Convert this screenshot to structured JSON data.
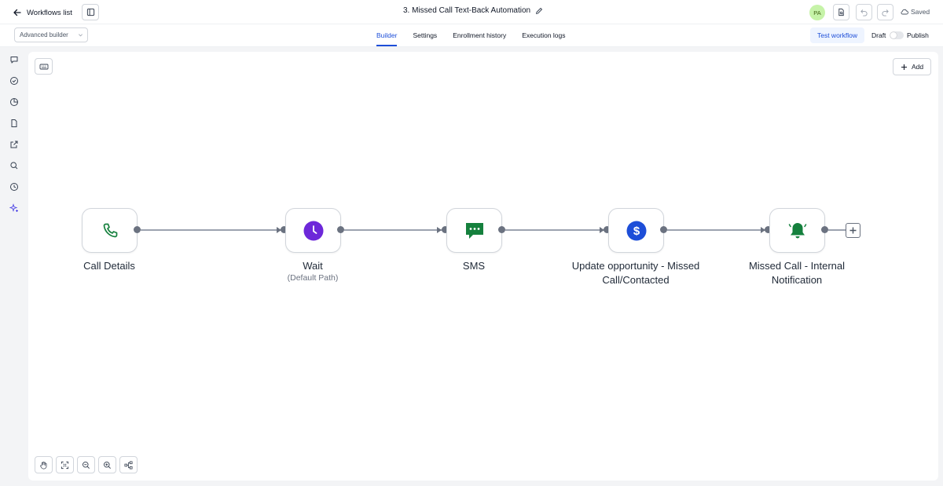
{
  "header": {
    "back_label": "Workflows list",
    "workflow_title": "3. Missed Call Text-Back Automation",
    "avatar_initials": "PA",
    "save_status": "Saved"
  },
  "subbar": {
    "builder_mode": "Advanced builder",
    "tabs": [
      {
        "label": "Builder",
        "active": true
      },
      {
        "label": "Settings",
        "active": false
      },
      {
        "label": "Enrollment history",
        "active": false
      },
      {
        "label": "Execution logs",
        "active": false
      }
    ],
    "test_button": "Test workflow",
    "draft_label": "Draft",
    "publish_label": "Publish",
    "publish_toggle_on": false
  },
  "sidebar": {
    "icons": [
      "chat-icon",
      "check-circle-icon",
      "pie-chart-icon",
      "document-icon",
      "external-link-icon",
      "search-icon",
      "history-icon",
      "sparkle-icon"
    ]
  },
  "canvas": {
    "add_label": "Add",
    "nodes": [
      {
        "label": "Call Details",
        "sublabel": "",
        "icon": "phone-icon",
        "color": "#15803d"
      },
      {
        "label": "Wait",
        "sublabel": "(Default Path)",
        "icon": "clock-icon",
        "color": "#6d28d9"
      },
      {
        "label": "SMS",
        "sublabel": "",
        "icon": "sms-icon",
        "color": "#15803d"
      },
      {
        "label": "Update opportunity - Missed Call/Contacted",
        "sublabel": "",
        "icon": "dollar-icon",
        "color": "#1d4ed8"
      },
      {
        "label": "Missed Call - Internal Notification",
        "sublabel": "",
        "icon": "bell-icon",
        "color": "#15803d"
      }
    ],
    "zoom_controls": [
      "pan-hand-icon",
      "fit-view-icon",
      "zoom-out-icon",
      "zoom-in-icon",
      "auto-layout-icon"
    ]
  }
}
